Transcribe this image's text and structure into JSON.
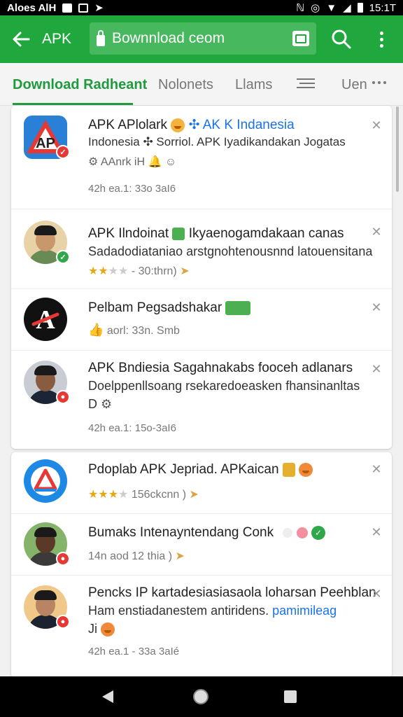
{
  "status_bar": {
    "left_text": "Aloes AlH",
    "time": "15:1T"
  },
  "app_bar": {
    "title": "APK",
    "url": "Bownnload ceom"
  },
  "colors": {
    "brand_green": "#20a83f",
    "tab_green": "#1f9a3d"
  },
  "tabs": [
    {
      "label": "Download Radheant",
      "active": true
    },
    {
      "label": "Nolonets",
      "active": false
    },
    {
      "label": "Llams",
      "active": false
    },
    {
      "label": "Uen",
      "active": false
    }
  ],
  "items": [
    {
      "title": "APK APlolark",
      "title_extra": "✣ AK K Indanesia",
      "sub": "Indonesia ✣ Sorriol. APK Iyadikandakan Jogatas",
      "meta2": "AAnrk iH",
      "meta": "42h ea.1: 33o 3aI6",
      "avatar": "apk-logo",
      "badge_color": "#e53935"
    },
    {
      "title": "APK Ilndoinat",
      "title_extra": "Ikyaenogamdakaan canas",
      "sub": "Sadadodiataniao arstgnohtenousnnd latouensitana",
      "stars": 2,
      "meta": "- 30:thrn)",
      "avatar": "person-1",
      "badge_color": "#2ea84b"
    },
    {
      "title": "Pelbam Pegsadshakar",
      "meta": "aorl: 33n. Smb",
      "avatar": "brand-a-logo",
      "badge_color": ""
    },
    {
      "title": "APK Bndiesia Sagahnakabs fooceh adlanars",
      "sub": "Doelppenllsoang rsekaredoeasken fhansinanltas",
      "sub2": "D",
      "meta": "42h ea.1: 15o-3aI6",
      "avatar": "person-2",
      "badge_color": "#e53935"
    },
    {
      "title": "Pdoplab APK Jepriad. APKaican",
      "stars": 3,
      "meta": "156ckcnn )",
      "avatar": "delta-logo",
      "badge_color": ""
    },
    {
      "title": "Bumaks Intenayntendang Conk",
      "meta": "14n aod 12 thia )",
      "avatar": "person-3",
      "badge_color": "#e53935"
    },
    {
      "title": "Pencks IP kartadesiasiasaola loharsan Peehblan",
      "sub": "Ham enstiadanestem antiridens.",
      "sub_link": "pamimileag",
      "sub2": "Ji",
      "meta": "42h ea.1 - 33a 3aIé",
      "avatar": "person-4",
      "badge_color": "#e53935"
    }
  ]
}
